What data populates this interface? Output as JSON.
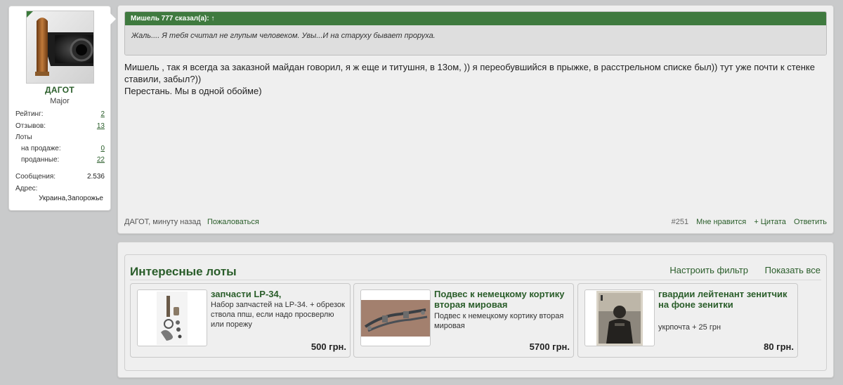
{
  "user": {
    "name": "ДАГОТ",
    "rank": "Major",
    "stats": {
      "rating_label": "Рейтинг:",
      "rating_value": "2",
      "reviews_label": "Отзывов:",
      "reviews_value": "13",
      "lots_label": "Лоты",
      "on_sale_label": "на продаже:",
      "on_sale_value": "0",
      "sold_label": "проданные:",
      "sold_value": "22",
      "messages_label": "Сообщения:",
      "messages_value": "2.536",
      "address_label": "Адрес:",
      "address_value": "Украина,Запорожье"
    },
    "avatar_icon": "pistol-cartridge-icon"
  },
  "post": {
    "quote": {
      "header": "Мишель 777 сказал(а): ↑",
      "text": "Жаль.... Я тебя считал не глупым человеком. Увы...И на старуху бывает проруха."
    },
    "message_line1": "Мишель , так я всегда за заказной майдан говорил, я ж еще и титушня, в 13ом, )) я переобувшийся в прыжке, в расстрельном списке был)) тут уже почти к стенке ставили, забыл?))",
    "message_line2": "Перестань. Мы в одной обойме)",
    "footer": {
      "author_time": "ДАГОТ, минуту назад",
      "report": "Пожаловаться",
      "post_number": "#251",
      "like": "Мне нравится",
      "quote": "+ Цитата",
      "reply": "Ответить"
    }
  },
  "lots": {
    "title": "Интересные лоты",
    "filter_link": "Настроить фильтр",
    "show_all_link": "Показать все",
    "items": [
      {
        "title": "запчасти LP-34,",
        "desc": "Набор запчастей на LP-34. + обрезок ствола ппш, если надо просверлю или порежу",
        "price": "500 грн.",
        "image_icon": "parts-photo-icon"
      },
      {
        "title": "Подвес к немецкому кортику вторая мировая",
        "desc": "Подвес к немецкому кортику вторая мировая",
        "price": "5700 грн.",
        "image_icon": "dagger-hanger-photo-icon"
      },
      {
        "title": "гвардии лейтенант зенитчик на фоне зенитки",
        "desc": "укрпочта + 25 грн",
        "price": "80 грн.",
        "image_icon": "old-photo-icon"
      }
    ]
  },
  "colors": {
    "accent_green": "#3f7a3f",
    "link_green": "#2a5d2a",
    "background": "#c9cacb",
    "panel": "#efefef"
  }
}
